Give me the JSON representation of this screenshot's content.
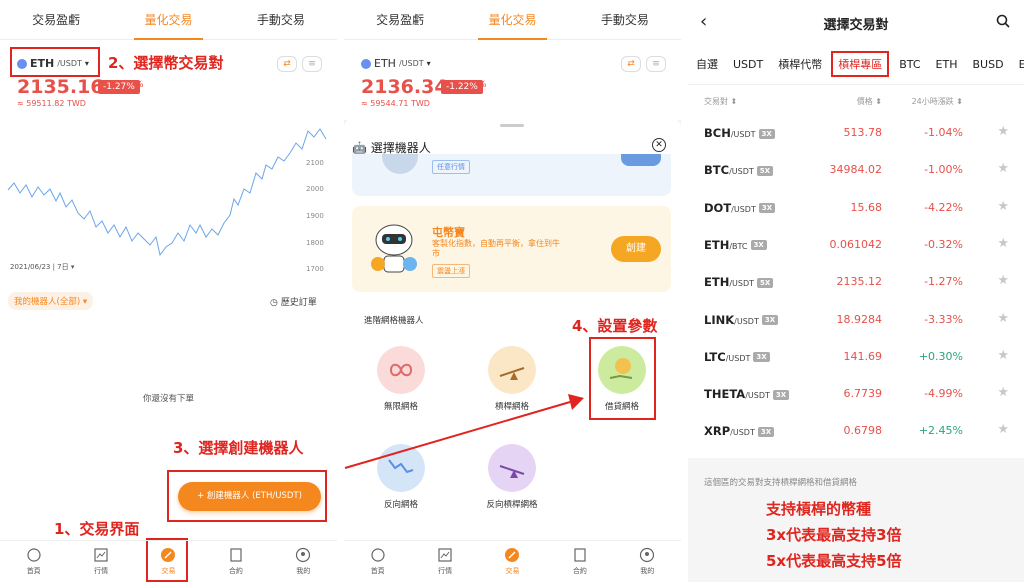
{
  "panel1": {
    "tabs": [
      "交易盈虧",
      "量化交易",
      "手動交易"
    ],
    "pair": {
      "base": "ETH",
      "quote": "/USDT",
      "arrow": "▾"
    },
    "price": "2135.16",
    "change": "-1.27%",
    "twd": "≈ 59511.82 TWD",
    "chart_date": "2021/06/23 | 7日 ▾",
    "y_ticks": [
      "2100",
      "2000",
      "1900",
      "1800",
      "1700"
    ],
    "my_bots": "我的機器人(全部) ▾",
    "history": "歷史訂單",
    "empty": "你還沒有下單",
    "create_button": "+ 創建機器人 (ETH/USDT)",
    "nav": [
      "首頁",
      "行情",
      "交易",
      "合約",
      "我的"
    ],
    "anno_2": "2、選擇幣交易對",
    "anno_3": "3、選擇創建機器人",
    "anno_1": "1、交易界面"
  },
  "panel2": {
    "tabs": [
      "交易盈虧",
      "量化交易",
      "手動交易"
    ],
    "pair": {
      "base": "ETH",
      "quote": "/USDT",
      "arrow": "▾"
    },
    "price": "2136.34",
    "change": "-1.22%",
    "twd": "≈ 59544.71 TWD",
    "sheet_title": "選擇機器人",
    "card_tag_top": "任意行情",
    "card_title": "屯幣寶",
    "card_desc": "客製化指數，自動再平衡，拿住到牛市",
    "card_tag": "震盪上漲",
    "create": "創建",
    "section": "進階網格機器人",
    "bots": [
      "無限網格",
      "槓桿網格",
      "借貸網格",
      "反向網格",
      "反向槓桿網格"
    ],
    "nav": [
      "首頁",
      "行情",
      "交易",
      "合約",
      "我的"
    ],
    "anno_4": "4、設置參數"
  },
  "panel3": {
    "title": "選擇交易對",
    "market_tabs": [
      "自選",
      "USDT",
      "槓桿代幣",
      "槓桿專區",
      "BTC",
      "ETH",
      "BUSD",
      "E"
    ],
    "head": {
      "pair": "交易對 ⬍",
      "price": "價格 ⬍",
      "change": "24小時漲跌 ⬍"
    },
    "rows": [
      {
        "base": "BCH",
        "quote": "/USDT",
        "lev": "3X",
        "price": "513.78",
        "chg": "-1.04%"
      },
      {
        "base": "BTC",
        "quote": "/USDT",
        "lev": "5X",
        "price": "34984.02",
        "chg": "-1.00%"
      },
      {
        "base": "DOT",
        "quote": "/USDT",
        "lev": "3X",
        "price": "15.68",
        "chg": "-4.22%"
      },
      {
        "base": "ETH",
        "quote": "/BTC",
        "lev": "3X",
        "price": "0.061042",
        "chg": "-0.32%"
      },
      {
        "base": "ETH",
        "quote": "/USDT",
        "lev": "5X",
        "price": "2135.12",
        "chg": "-1.27%"
      },
      {
        "base": "LINK",
        "quote": "/USDT",
        "lev": "3X",
        "price": "18.9284",
        "chg": "-3.33%"
      },
      {
        "base": "LTC",
        "quote": "/USDT",
        "lev": "3X",
        "price": "141.69",
        "chg": "+0.30%"
      },
      {
        "base": "THETA",
        "quote": "/USDT",
        "lev": "3X",
        "price": "6.7739",
        "chg": "-4.99%"
      },
      {
        "base": "XRP",
        "quote": "/USDT",
        "lev": "3X",
        "price": "0.6798",
        "chg": "+2.45%"
      }
    ],
    "footer": "這個區的交易對支持槓桿網格和借貸網格",
    "anno_lines": [
      "支持槓桿的幣種",
      "3x代表最高支持3倍",
      "5x代表最高支持5倍"
    ]
  },
  "colors": {
    "accent": "#f5871f",
    "down": "#e8504a",
    "up": "#2aa67a",
    "annotation": "#e0251f"
  }
}
